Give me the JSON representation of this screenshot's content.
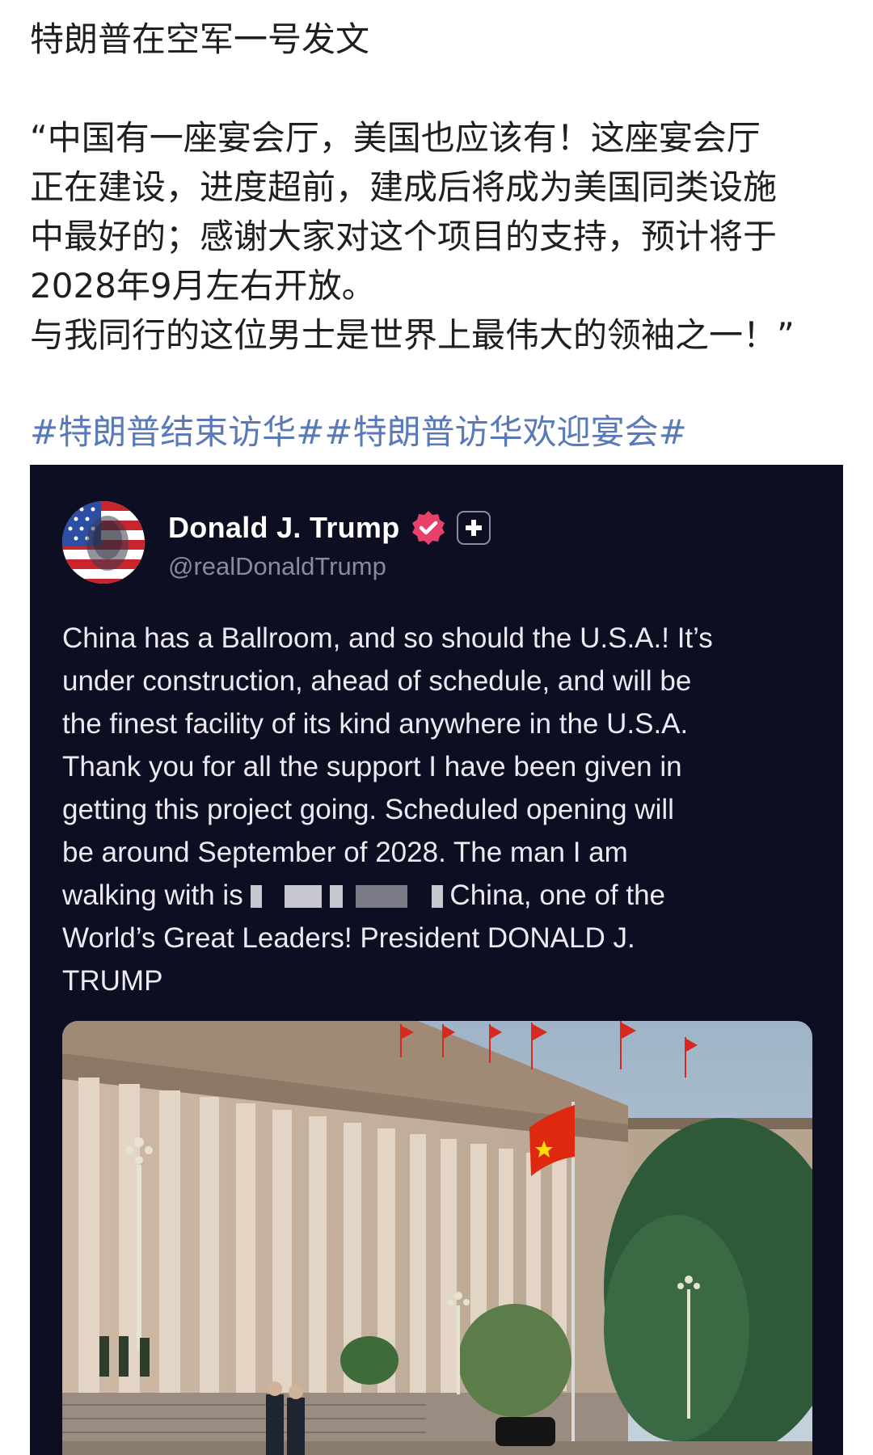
{
  "post": {
    "title": "特朗普在空军一号发文",
    "quote_lines": [
      "“中国有一座宴会厅，美国也应该有！这座宴会厅",
      "正在建设，进度超前，建成后将成为美国同类设施",
      "中最好的；感谢大家对这个项目的支持，预计将于",
      "2028年9月左右开放。",
      "与我同行的这位男士是世界上最伟大的领袖之一！”"
    ],
    "hashtags": [
      "#特朗普结束访华#",
      "#特朗普访华欢迎宴会#"
    ]
  },
  "embed": {
    "display_name": "Donald J. Trump",
    "handle": "@realDonaldTrump",
    "avatar_icon": "trump-flag-avatar",
    "verified_icon": "verified-badge-icon",
    "plus_icon": "plus-icon",
    "background": "#0e0e23",
    "verified_color": "#e8426a",
    "body_lines": [
      "China has a Ballroom, and so should the U.S.A.! It’s",
      "under construction, ahead of schedule, and will be",
      "the finest facility of its kind anywhere in the U.S.A.",
      "Thank you for all the support I have been given in",
      "getting this project going. Scheduled opening will",
      "be around September of 2028. The man I am"
    ],
    "body_line7_start": "walking with is ",
    "body_line7_end": "China, one of the",
    "body_lines_end": [
      "World’s Great Leaders! President DONALD J.",
      "TRUMP"
    ],
    "photo_alt": "Great Hall of the People with Chinese flags and two men walking"
  }
}
